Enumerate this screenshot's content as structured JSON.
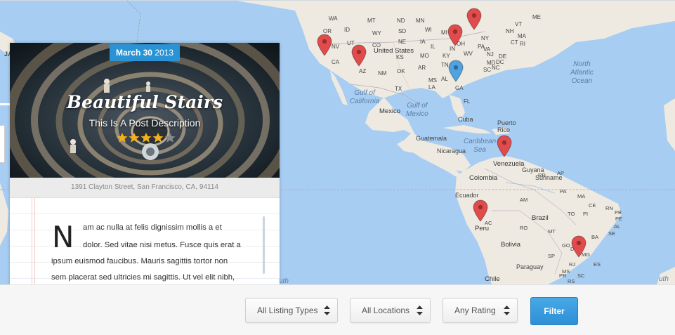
{
  "map": {
    "labels": {
      "usa": "United States",
      "mexico": "Mexico",
      "gulf_mexico": "Gulf of\nMexico",
      "gulf_california": "Gulf of\nCalifornia",
      "north_atlantic": "North\nAtlantic\nOcean",
      "cuba": "Cuba",
      "puerto_rico": "Puerto\nRico",
      "caribbean": "Caribbean\nSea",
      "guatemala": "Guatemala",
      "nicaragua": "Nicaragua",
      "venezuela": "Venezuela",
      "guyana": "Guyana",
      "suriname": "Suriname",
      "colombia": "Colombia",
      "ecuador": "Ecuador",
      "peru": "Peru",
      "brazil": "Brazil",
      "bolivia": "Bolivia",
      "paraguay": "Paraguay",
      "chile": "Chile",
      "states": [
        "WA",
        "MT",
        "ND",
        "MN",
        "OR",
        "ID",
        "WY",
        "SD",
        "WI",
        "MI",
        "VT",
        "ME",
        "NV",
        "UT",
        "CO",
        "NE",
        "IA",
        "IL",
        "IN",
        "OH",
        "PA",
        "NY",
        "NH",
        "MA",
        "CT",
        "RI",
        "NJ",
        "DE",
        "MD",
        "DC",
        "CA",
        "AZ",
        "NM",
        "KS",
        "MO",
        "KY",
        "WV",
        "VA",
        "OK",
        "AR",
        "TN",
        "NC",
        "SC",
        "TX",
        "LA",
        "MS",
        "AL",
        "GA",
        "FL"
      ],
      "regions_br": [
        "AM",
        "PA",
        "MA",
        "CE",
        "RN",
        "PB",
        "PE",
        "AL",
        "SE",
        "BA",
        "TO",
        "PI",
        "MT",
        "GO",
        "MG",
        "ES",
        "RJ",
        "SP",
        "MS",
        "PR",
        "SC",
        "RS",
        "RO",
        "AC",
        "AP",
        "RR",
        "DF"
      ],
      "jal": "JAL",
      "uth": "uth",
      "ith": "uth"
    },
    "pins": [
      {
        "name": "pin-california",
        "color": "#e14b4b"
      },
      {
        "name": "pin-arizona",
        "color": "#e14b4b"
      },
      {
        "name": "pin-new-york",
        "color": "#e14b4b"
      },
      {
        "name": "pin-ohio",
        "color": "#e14b4b"
      },
      {
        "name": "pin-georgia",
        "color": "#4fa3e0"
      },
      {
        "name": "pin-venezuela",
        "color": "#e14b4b"
      },
      {
        "name": "pin-peru",
        "color": "#e14b4b"
      },
      {
        "name": "pin-brazil",
        "color": "#e14b4b"
      }
    ]
  },
  "card": {
    "date_bold": "March 30",
    "date_year": "2013",
    "title": "Beautiful Stairs",
    "description": "This Is A Post Description",
    "rating": 4,
    "rating_max": 5,
    "address": "1391 Clayton Street, San Francisco, CA, 94114",
    "dropcap": "N",
    "lines": [
      "am ac nulla at felis dignissim mollis a et",
      "dolor. Sed vitae nisi metus. Fusce quis erat a",
      "ipsum euismod faucibus. Mauris sagittis tortor non",
      "sem placerat sed ultricies mi sagittis. Ut vel elit nibh,"
    ]
  },
  "filters": {
    "listing_types": "All Listing Types",
    "locations": "All Locations",
    "rating": "Any Rating",
    "button": "Filter"
  },
  "colors": {
    "ocean": "#a7cdf2",
    "land": "#eeeae1",
    "accent": "#2a93d5",
    "pin_red": "#e14b4b",
    "pin_blue": "#4fa3e0"
  }
}
